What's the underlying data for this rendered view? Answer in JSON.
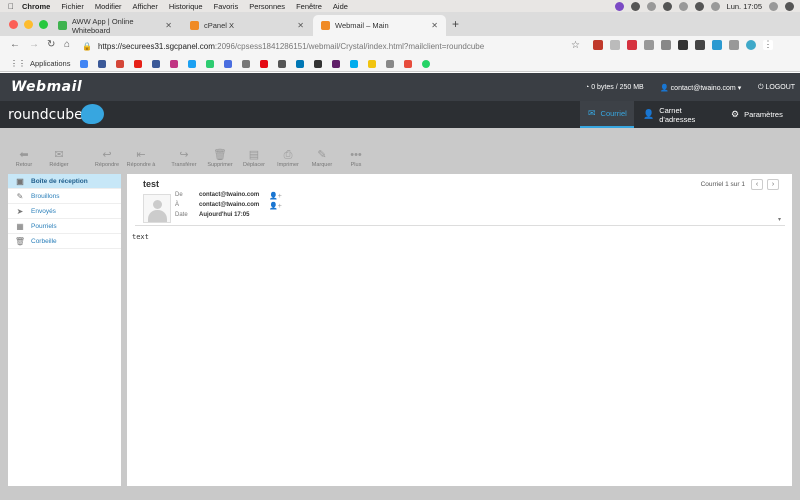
{
  "macos": {
    "app_name": "Chrome",
    "menus": [
      "Fichier",
      "Modifier",
      "Afficher",
      "Historique",
      "Favoris",
      "Personnes",
      "Fenêtre",
      "Aide"
    ],
    "clock": "Lun. 17:05"
  },
  "browser": {
    "tabs": [
      {
        "title": "AWW App | Online Whiteboard",
        "favicon_color": "#3fb34f",
        "active": false
      },
      {
        "title": "cPanel X",
        "favicon_color": "#f08a24",
        "active": false
      },
      {
        "title": "Webmail – Main",
        "favicon_color": "#f08a24",
        "active": true
      }
    ],
    "url_host": "https://securees31.sgcpanel.com",
    "url_rest": ":2096/cpsess1841286151/webmail/Crystal/index.html?mailclient=roundcube",
    "bookmarks_label": "Applications"
  },
  "webmail": {
    "logo": "Webmail",
    "brand": "roundcube",
    "quota": "0 bytes / 250 MB",
    "user": "contact@twaino.com",
    "logout": "LOGOUT",
    "nav": [
      {
        "label": "Courriel",
        "icon": "mail-icon",
        "selected": true
      },
      {
        "label": "Carnet d'adresses",
        "icon": "contacts-icon",
        "selected": false
      },
      {
        "label": "Paramètres",
        "icon": "gear-icon",
        "selected": false
      }
    ]
  },
  "actions": [
    {
      "label": "Retour",
      "icon": "back-icon"
    },
    {
      "label": "Rédiger",
      "icon": "compose-icon"
    },
    {
      "label": "Répondre",
      "icon": "reply-icon"
    },
    {
      "label": "Répondre à",
      "icon": "reply-all-icon"
    },
    {
      "label": "Transférer",
      "icon": "forward-icon"
    },
    {
      "label": "Supprimer",
      "icon": "trash-icon"
    },
    {
      "label": "Déplacer",
      "icon": "move-icon"
    },
    {
      "label": "Imprimer",
      "icon": "print-icon"
    },
    {
      "label": "Marquer",
      "icon": "mark-icon"
    },
    {
      "label": "Plus",
      "icon": "more-icon"
    }
  ],
  "folders": [
    {
      "label": "Boîte de réception",
      "icon": "inbox-icon",
      "selected": true
    },
    {
      "label": "Brouillons",
      "icon": "drafts-icon",
      "selected": false
    },
    {
      "label": "Envoyés",
      "icon": "sent-icon",
      "selected": false
    },
    {
      "label": "Pourriels",
      "icon": "junk-icon",
      "selected": false
    },
    {
      "label": "Corbeille",
      "icon": "trash-folder-icon",
      "selected": false
    }
  ],
  "message": {
    "subject": "test",
    "counter": "Courriel 1 sur 1",
    "from_label": "De",
    "from": "contact@twaino.com",
    "to_label": "À",
    "to": "contact@twaino.com",
    "date_label": "Date",
    "date": "Aujourd'hui 17:05",
    "body": "text"
  }
}
